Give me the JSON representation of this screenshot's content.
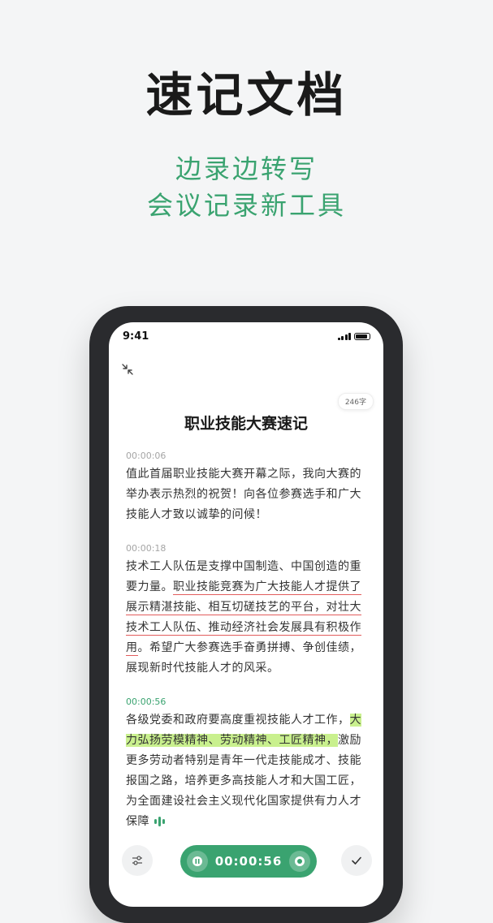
{
  "hero": {
    "title": "速记文档",
    "subtitle_1": "边录边转写",
    "subtitle_2": "会议记录新工具"
  },
  "status_bar": {
    "time": "9:41"
  },
  "document": {
    "word_count": "246字",
    "title": "职业技能大赛速记"
  },
  "segments": [
    {
      "timestamp": "00:00:06",
      "text": "值此首届职业技能大赛开幕之际，我向大赛的举办表示热烈的祝贺！向各位参赛选手和广大技能人才致以诚挚的问候！"
    },
    {
      "timestamp": "00:00:18",
      "text_before": "技术工人队伍是支撑中国制造、中国创造的重要力量。",
      "text_underlined": "职业技能竞赛为广大技能人才提供了展示精湛技能、相互切磋技艺的平台，对壮大技术工人队伍、推动经济社会发展具有积极作用",
      "text_after": "。希望广大参赛选手奋勇拼搏、争创佳绩，展现新时代技能人才的风采。"
    },
    {
      "timestamp": "00:00:56",
      "text_before": "各级党委和政府要高度重视技能人才工作，",
      "text_highlighted": "大力弘扬劳模精神、劳动精神、工匠精神，",
      "text_after": "激励更多劳动者特别是青年一代走技能成才、技能报国之路，培养更多高技能人才和大国工匠，为全面建设社会主义现代化国家提供有力人才保障"
    }
  ],
  "controls": {
    "record_time": "00:00:56"
  },
  "colors": {
    "accent": "#3aa370",
    "highlight": "#c9f08e",
    "underline": "#e25d5d"
  },
  "icons": [
    "collapse-icon",
    "settings-sliders-icon",
    "recorder-icon",
    "checkmark-icon",
    "audio-wave-icon"
  ]
}
